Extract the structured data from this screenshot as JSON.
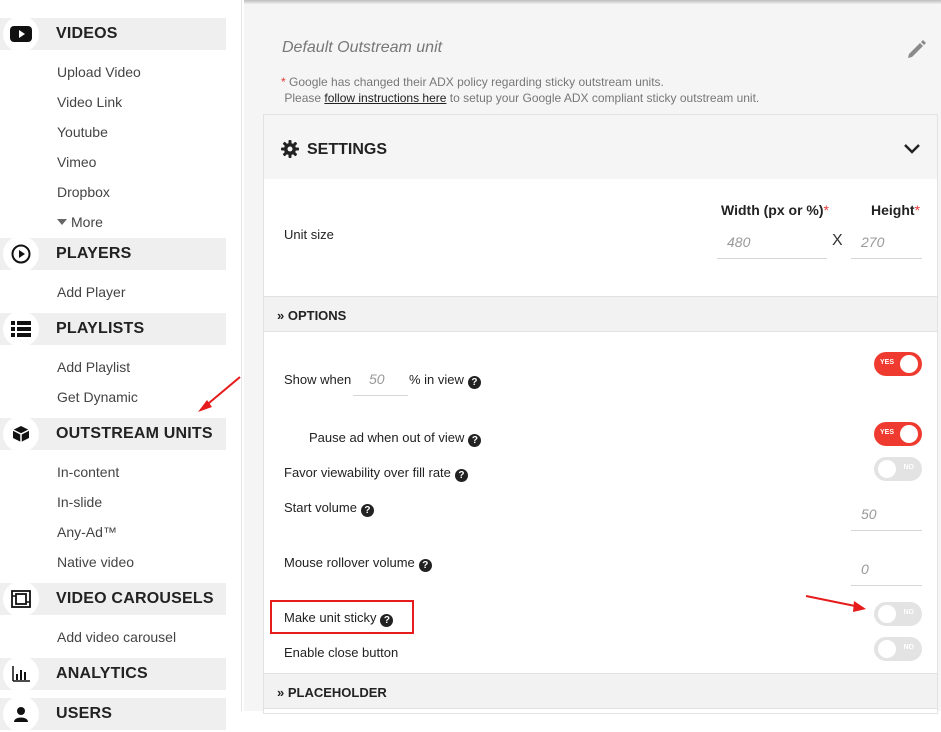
{
  "sidebar": {
    "sections": [
      {
        "label": "VIDEOS",
        "icon": "youtube-icon",
        "items": [
          "Upload Video",
          "Video Link",
          "Youtube",
          "Vimeo",
          "Dropbox",
          "More"
        ]
      },
      {
        "label": "PLAYERS",
        "icon": "play-circle-icon",
        "items": [
          "Add Player"
        ]
      },
      {
        "label": "PLAYLISTS",
        "icon": "list-icon",
        "items": [
          "Add Playlist",
          "Get Dynamic"
        ]
      },
      {
        "label": "OUTSTREAM UNITS",
        "icon": "cube-icon",
        "items": [
          "In-content",
          "In-slide",
          "Any-Ad™",
          "Native video"
        ]
      },
      {
        "label": "VIDEO CAROUSELS",
        "icon": "carousel-icon",
        "items": [
          "Add video carousel"
        ]
      },
      {
        "label": "ANALYTICS",
        "icon": "analytics-chart-icon",
        "items": []
      },
      {
        "label": "USERS",
        "icon": "user-icon",
        "items": []
      }
    ]
  },
  "unit": {
    "title": "Default Outstream unit",
    "note_star": "*",
    "note_line1": " Google has changed their ADX policy regarding sticky outstream units.",
    "note_line2_pre": "Please ",
    "note_link": "follow instructions here",
    "note_line2_post": " to setup your Google ADX compliant sticky outstream unit."
  },
  "settings": {
    "title": "SETTINGS",
    "unit_size_label": "Unit size",
    "width_head": "Width (px or %)",
    "height_head": "Height",
    "req": "*",
    "width_placeholder": "480",
    "height_placeholder": "270",
    "x_sep": "X"
  },
  "options": {
    "title": "OPTIONS",
    "show_when_label": "Show when",
    "show_when_value": "50",
    "in_view_label": "% in view",
    "pause_label": "Pause ad when out of view",
    "favor_label": "Favor viewability over fill rate",
    "start_volume_label": "Start volume",
    "start_volume_value": "50",
    "mouse_rollover_label": "Mouse rollover volume",
    "mouse_rollover_value": "0",
    "sticky_label": "Make unit sticky",
    "close_button_label": "Enable close button",
    "yes": "YES",
    "no": "NO",
    "help": "?"
  },
  "placeholder": {
    "title": "PLACEHOLDER"
  },
  "colors": {
    "accent": "#ef3b2f",
    "annotation": "#e61b1b"
  }
}
